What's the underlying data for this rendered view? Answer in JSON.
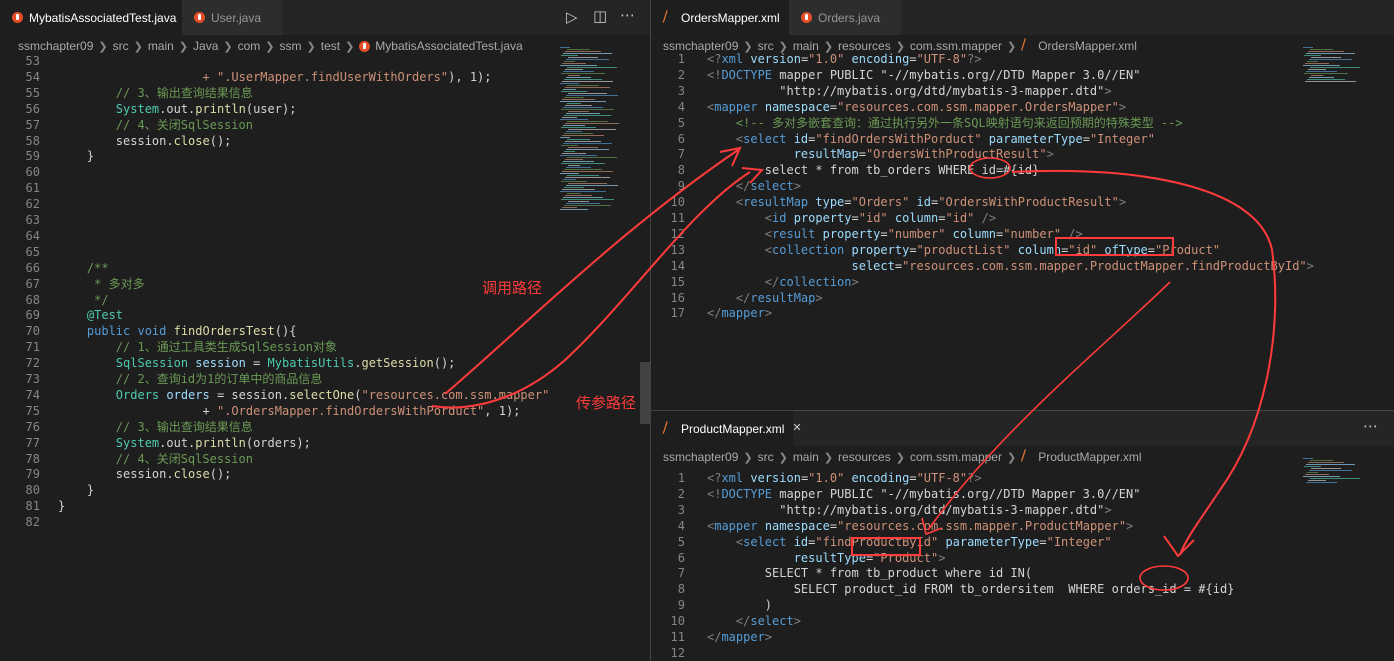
{
  "left": {
    "tabs": [
      {
        "label": "MybatisAssociatedTest.java",
        "active": true
      },
      {
        "label": "User.java",
        "active": false
      }
    ],
    "breadcrumb": [
      "ssmchapter09",
      "src",
      "main",
      "Java",
      "com",
      "ssm",
      "test",
      "MybatisAssociatedTest.java"
    ],
    "lines": [
      {
        "n": "53",
        "x": []
      },
      {
        "n": "54",
        "x": [
          [
            "s",
            "                    + \".UserMapper.findUserWithOrders\""
          ],
          [
            "",
            "), 1);"
          ]
        ]
      },
      {
        "n": "55",
        "x": [
          [
            "c",
            "        // 3、输出查询结果信息"
          ]
        ]
      },
      {
        "n": "56",
        "x": [
          [
            "t",
            "        System"
          ],
          [
            "",
            ".out."
          ],
          [
            "f",
            "println"
          ],
          [
            "",
            "(user);"
          ]
        ]
      },
      {
        "n": "57",
        "x": [
          [
            "c",
            "        // 4、关闭SqlSession"
          ]
        ]
      },
      {
        "n": "58",
        "x": [
          [
            "",
            "        session."
          ],
          [
            "f",
            "close"
          ],
          [
            "",
            "();"
          ]
        ]
      },
      {
        "n": "59",
        "x": [
          [
            "",
            "    }"
          ]
        ]
      },
      {
        "n": "60",
        "x": []
      },
      {
        "n": "61",
        "x": []
      },
      {
        "n": "62",
        "x": []
      },
      {
        "n": "63",
        "x": []
      },
      {
        "n": "64",
        "x": []
      },
      {
        "n": "65",
        "x": []
      },
      {
        "n": "66",
        "x": [
          [
            "c",
            "    /**"
          ]
        ]
      },
      {
        "n": "67",
        "x": [
          [
            "c",
            "     * 多对多"
          ]
        ]
      },
      {
        "n": "68",
        "x": [
          [
            "c",
            "     */"
          ]
        ]
      },
      {
        "n": "69",
        "x": [
          [
            "t",
            "    @Test"
          ]
        ]
      },
      {
        "n": "70",
        "x": [
          [
            "k",
            "    public void "
          ],
          [
            "f",
            "findOrdersTest"
          ],
          [
            "",
            "(){"
          ]
        ]
      },
      {
        "n": "71",
        "x": [
          [
            "c",
            "        // 1、通过工具类生成SqlSession对象"
          ]
        ]
      },
      {
        "n": "72",
        "x": [
          [
            "t",
            "        SqlSession "
          ],
          [
            "a",
            "session"
          ],
          [
            "",
            " = "
          ],
          [
            "t",
            "MybatisUtils"
          ],
          [
            "",
            "."
          ],
          [
            "f",
            "getSession"
          ],
          [
            "",
            "();"
          ]
        ]
      },
      {
        "n": "73",
        "x": [
          [
            "c",
            "        // 2、查询id为1的订单中的商品信息"
          ]
        ]
      },
      {
        "n": "74",
        "x": [
          [
            "t",
            "        Orders "
          ],
          [
            "a",
            "orders"
          ],
          [
            "",
            " = session."
          ],
          [
            "f",
            "selectOne"
          ],
          [
            "",
            "("
          ],
          [
            "s",
            "\"resources.com.ssm.mapper\""
          ]
        ]
      },
      {
        "n": "75",
        "x": [
          [
            "",
            "                    + "
          ],
          [
            "s",
            "\".OrdersMapper.findOrdersWithPorduct\""
          ],
          [
            "",
            ", 1);"
          ]
        ]
      },
      {
        "n": "76",
        "x": [
          [
            "c",
            "        // 3、输出查询结果信息"
          ]
        ]
      },
      {
        "n": "77",
        "x": [
          [
            "t",
            "        System"
          ],
          [
            "",
            ".out."
          ],
          [
            "f",
            "println"
          ],
          [
            "",
            "(orders);"
          ]
        ]
      },
      {
        "n": "78",
        "x": [
          [
            "c",
            "        // 4、关闭SqlSession"
          ]
        ]
      },
      {
        "n": "79",
        "x": [
          [
            "",
            "        session."
          ],
          [
            "f",
            "close"
          ],
          [
            "",
            "();"
          ]
        ]
      },
      {
        "n": "80",
        "x": [
          [
            "",
            "    }"
          ]
        ]
      },
      {
        "n": "81",
        "x": [
          [
            "",
            "}"
          ]
        ]
      },
      {
        "n": "82",
        "x": []
      }
    ]
  },
  "right_top": {
    "tabs": [
      {
        "label": "OrdersMapper.xml",
        "active": true
      },
      {
        "label": "Orders.java",
        "active": false
      }
    ],
    "breadcrumb": [
      "ssmchapter09",
      "src",
      "main",
      "resources",
      "com.ssm.mapper",
      "OrdersMapper.xml"
    ],
    "lines": [
      {
        "n": "1",
        "x": [
          [
            "p",
            "<?"
          ],
          [
            "k",
            "xml "
          ],
          [
            "a",
            "version"
          ],
          [
            "",
            "="
          ],
          [
            "s",
            "\"1.0\" "
          ],
          [
            "a",
            "encoding"
          ],
          [
            "",
            "="
          ],
          [
            "s",
            "\"UTF-8\""
          ],
          [
            "p",
            "?>"
          ]
        ]
      },
      {
        "n": "2",
        "x": [
          [
            "p",
            "<!"
          ],
          [
            "k",
            "DOCTYPE "
          ],
          [
            "",
            "mapper PUBLIC \"-//mybatis.org//DTD Mapper 3.0//EN\""
          ]
        ]
      },
      {
        "n": "3",
        "x": [
          [
            "",
            "          \"http://mybatis.org/dtd/mybatis-3-mapper.dtd\""
          ],
          [
            "p",
            ">"
          ]
        ]
      },
      {
        "n": "4",
        "x": [
          [
            "p",
            "<"
          ],
          [
            "k",
            "mapper "
          ],
          [
            "a",
            "namespace"
          ],
          [
            "",
            "="
          ],
          [
            "s",
            "\"resources.com.ssm.mapper.OrdersMapper\""
          ],
          [
            "p",
            ">"
          ]
        ]
      },
      {
        "n": "5",
        "x": [
          [
            "c",
            "    <!-- 多对多嵌套查询：通过执行另外一条SQL映射语句来返回预期的特殊类型 -->"
          ]
        ]
      },
      {
        "n": "6",
        "x": [
          [
            "p",
            "    <"
          ],
          [
            "k",
            "select "
          ],
          [
            "a",
            "id"
          ],
          [
            "",
            "="
          ],
          [
            "s",
            "\"findOrdersWithPorduct\" "
          ],
          [
            "a",
            "parameterType"
          ],
          [
            "",
            "="
          ],
          [
            "s",
            "\"Integer\""
          ]
        ]
      },
      {
        "n": "7",
        "x": [
          [
            "a",
            "            resultMap"
          ],
          [
            "",
            "="
          ],
          [
            "s",
            "\"OrdersWithProductResult\""
          ],
          [
            "p",
            ">"
          ]
        ]
      },
      {
        "n": "8",
        "x": [
          [
            "",
            "        select * from tb_orders WHERE id=#{id}"
          ]
        ]
      },
      {
        "n": "9",
        "x": [
          [
            "p",
            "    </"
          ],
          [
            "k",
            "select"
          ],
          [
            "p",
            ">"
          ]
        ]
      },
      {
        "n": "10",
        "x": [
          [
            "p",
            "    <"
          ],
          [
            "k",
            "resultMap "
          ],
          [
            "a",
            "type"
          ],
          [
            "",
            "="
          ],
          [
            "s",
            "\"Orders\" "
          ],
          [
            "a",
            "id"
          ],
          [
            "",
            "="
          ],
          [
            "s",
            "\"OrdersWithProductResult\""
          ],
          [
            "p",
            ">"
          ]
        ]
      },
      {
        "n": "11",
        "x": [
          [
            "p",
            "        <"
          ],
          [
            "k",
            "id "
          ],
          [
            "a",
            "property"
          ],
          [
            "",
            "="
          ],
          [
            "s",
            "\"id\" "
          ],
          [
            "a",
            "column"
          ],
          [
            "",
            "="
          ],
          [
            "s",
            "\"id\" "
          ],
          [
            "p",
            "/>"
          ]
        ]
      },
      {
        "n": "12",
        "x": [
          [
            "p",
            "        <"
          ],
          [
            "k",
            "result "
          ],
          [
            "a",
            "property"
          ],
          [
            "",
            "="
          ],
          [
            "s",
            "\"number\" "
          ],
          [
            "a",
            "column"
          ],
          [
            "",
            "="
          ],
          [
            "s",
            "\"number\" "
          ],
          [
            "p",
            "/>"
          ]
        ]
      },
      {
        "n": "13",
        "x": [
          [
            "p",
            "        <"
          ],
          [
            "k",
            "collection "
          ],
          [
            "a",
            "property"
          ],
          [
            "",
            "="
          ],
          [
            "s",
            "\"productList\" "
          ],
          [
            "a",
            "column"
          ],
          [
            "",
            "="
          ],
          [
            "s",
            "\"id\" "
          ],
          [
            "a",
            "ofType"
          ],
          [
            "",
            "="
          ],
          [
            "s",
            "\"Product\""
          ]
        ]
      },
      {
        "n": "14",
        "x": [
          [
            "a",
            "                    select"
          ],
          [
            "",
            "="
          ],
          [
            "s",
            "\"resources.com.ssm.mapper.ProductMapper.findProductById\""
          ],
          [
            "p",
            ">"
          ]
        ]
      },
      {
        "n": "15",
        "x": [
          [
            "p",
            "        </"
          ],
          [
            "k",
            "collection"
          ],
          [
            "p",
            ">"
          ]
        ]
      },
      {
        "n": "16",
        "x": [
          [
            "p",
            "    </"
          ],
          [
            "k",
            "resultMap"
          ],
          [
            "p",
            ">"
          ]
        ]
      },
      {
        "n": "17",
        "x": [
          [
            "p",
            "</"
          ],
          [
            "k",
            "mapper"
          ],
          [
            "p",
            ">"
          ]
        ]
      }
    ]
  },
  "right_bottom": {
    "tabs": [
      {
        "label": "ProductMapper.xml",
        "active": true
      }
    ],
    "breadcrumb": [
      "ssmchapter09",
      "src",
      "main",
      "resources",
      "com.ssm.mapper",
      "ProductMapper.xml"
    ],
    "lines": [
      {
        "n": "1",
        "x": [
          [
            "p",
            "<?"
          ],
          [
            "k",
            "xml "
          ],
          [
            "a",
            "version"
          ],
          [
            "",
            "="
          ],
          [
            "s",
            "\"1.0\" "
          ],
          [
            "a",
            "encoding"
          ],
          [
            "",
            "="
          ],
          [
            "s",
            "\"UTF-8\""
          ],
          [
            "p",
            "?>"
          ]
        ]
      },
      {
        "n": "2",
        "x": [
          [
            "p",
            "<!"
          ],
          [
            "k",
            "DOCTYPE "
          ],
          [
            "",
            "mapper PUBLIC \"-//mybatis.org//DTD Mapper 3.0//EN\""
          ]
        ]
      },
      {
        "n": "3",
        "x": [
          [
            "",
            "          \"http://mybatis.org/dtd/mybatis-3-mapper.dtd\""
          ],
          [
            "p",
            ">"
          ]
        ]
      },
      {
        "n": "4",
        "x": [
          [
            "p",
            "<"
          ],
          [
            "k",
            "mapper "
          ],
          [
            "a",
            "namespace"
          ],
          [
            "",
            "="
          ],
          [
            "s",
            "\"resources.com.ssm.mapper.ProductMapper\""
          ],
          [
            "p",
            ">"
          ]
        ]
      },
      {
        "n": "5",
        "x": [
          [
            "p",
            "    <"
          ],
          [
            "k",
            "select "
          ],
          [
            "a",
            "id"
          ],
          [
            "",
            "="
          ],
          [
            "s",
            "\"findProductById\" "
          ],
          [
            "a",
            "parameterType"
          ],
          [
            "",
            "="
          ],
          [
            "s",
            "\"Integer\""
          ]
        ]
      },
      {
        "n": "6",
        "x": [
          [
            "a",
            "            resultType"
          ],
          [
            "",
            "="
          ],
          [
            "s",
            "\"Product\""
          ],
          [
            "p",
            ">"
          ]
        ]
      },
      {
        "n": "7",
        "x": [
          [
            "",
            "        SELECT * from tb_product where id IN("
          ]
        ]
      },
      {
        "n": "8",
        "x": [
          [
            "",
            "            SELECT product_id FROM tb_ordersitem  WHERE orders_id = #{id}"
          ]
        ]
      },
      {
        "n": "9",
        "x": [
          [
            "",
            "        )"
          ]
        ]
      },
      {
        "n": "10",
        "x": [
          [
            "p",
            "    </"
          ],
          [
            "k",
            "select"
          ],
          [
            "p",
            ">"
          ]
        ]
      },
      {
        "n": "11",
        "x": [
          [
            "p",
            "</"
          ],
          [
            "k",
            "mapper"
          ],
          [
            "p",
            ">"
          ]
        ]
      },
      {
        "n": "12",
        "x": []
      }
    ]
  },
  "annotations": {
    "call_path": "调用路径",
    "param_path": "传参路径"
  },
  "icons": {
    "run": "run-icon",
    "split": "split-editor-icon",
    "more": "more-actions-icon"
  },
  "colors": {
    "annotation": "#ff3b3b",
    "editor_bg": "#1e1e1e"
  }
}
